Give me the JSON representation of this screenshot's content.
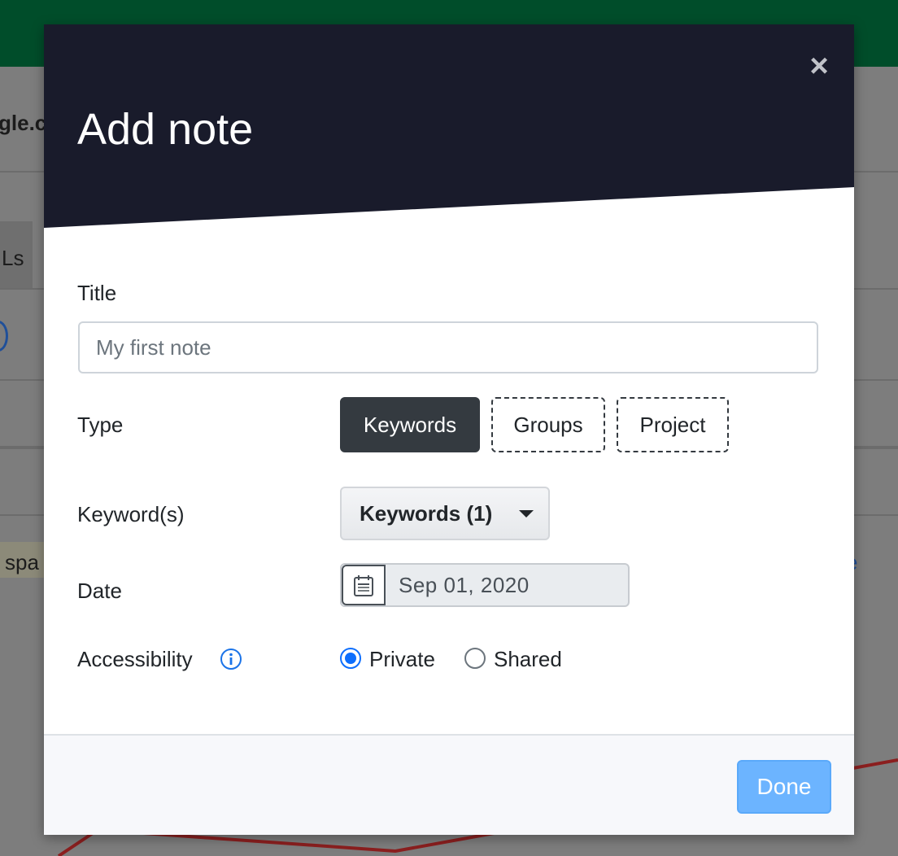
{
  "background": {
    "title_fragment": "gle.c",
    "column_fragment": "Ls",
    "tag_fragment": "spa",
    "link_fragment": "e"
  },
  "modal": {
    "title": "Add note",
    "close_icon": "close-icon",
    "fields": {
      "title_label": "Title",
      "title_placeholder": "My first note",
      "title_value": "",
      "type_label": "Type",
      "type_options": [
        "Keywords",
        "Groups",
        "Project"
      ],
      "type_selected": "Keywords",
      "keywords_label": "Keyword(s)",
      "keywords_dropdown": "Keywords (1)",
      "date_label": "Date",
      "date_value": "Sep 01, 2020",
      "date_icon": "calendar-icon",
      "accessibility_label": "Accessibility",
      "accessibility_icon": "info-icon",
      "accessibility_options": [
        "Private",
        "Shared"
      ],
      "accessibility_selected": "Private"
    },
    "footer": {
      "done_label": "Done"
    }
  },
  "colors": {
    "header_bg": "#191b2b",
    "primary": "#0d6efd",
    "done_button": "#6cb4ff",
    "active_type": "#343a40",
    "top_bar": "#004d2a"
  }
}
